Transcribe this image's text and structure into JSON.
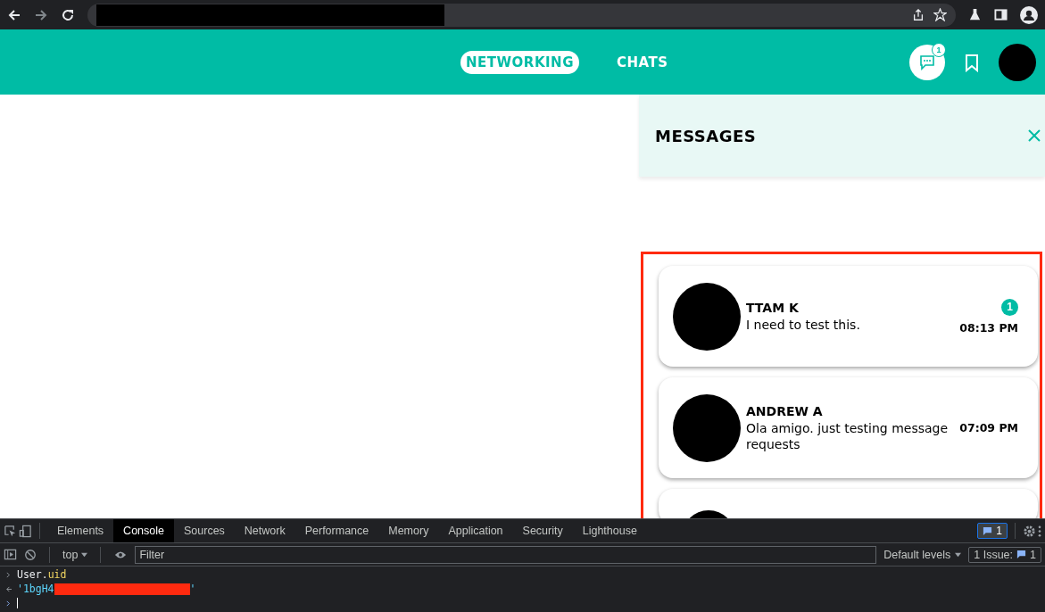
{
  "header": {
    "tabs": [
      {
        "label": "NETWORKING",
        "selected": true
      },
      {
        "label": "CHATS",
        "selected": false
      }
    ],
    "chat_badge": "1"
  },
  "messages": {
    "title": "MESSAGES",
    "conversations": [
      {
        "name": "TTAM K",
        "text": "I need to test this.",
        "time": "08:13 PM",
        "unread": "1"
      },
      {
        "name": "ANDREW A",
        "text": "Ola amigo. just testing message requests",
        "time": "07:09 PM"
      }
    ]
  },
  "devtools": {
    "tabs": [
      {
        "label": "Elements",
        "selected": false
      },
      {
        "label": "Console",
        "selected": true
      },
      {
        "label": "Sources",
        "selected": false
      },
      {
        "label": "Network",
        "selected": false
      },
      {
        "label": "Performance",
        "selected": false
      },
      {
        "label": "Memory",
        "selected": false
      },
      {
        "label": "Application",
        "selected": false
      },
      {
        "label": "Security",
        "selected": false
      },
      {
        "label": "Lighthouse",
        "selected": false
      }
    ],
    "messages_badge": "1",
    "context": "top",
    "filter_placeholder": "Filter",
    "levels": "Default levels",
    "issues_label": "1 Issue:",
    "issues_count": "1",
    "console": [
      {
        "kind": "input",
        "object": "User.",
        "property": "uid"
      },
      {
        "kind": "output",
        "text": "'1bgH4",
        "tail": "'"
      }
    ]
  }
}
